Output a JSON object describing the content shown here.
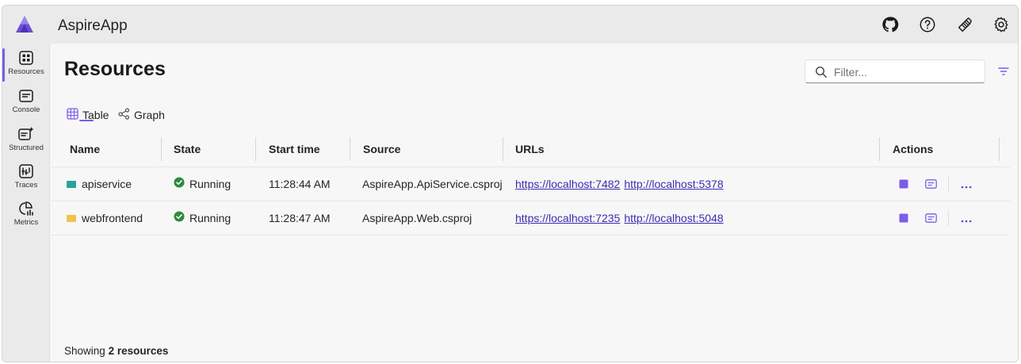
{
  "app": {
    "title": "AspireApp",
    "accent_color": "#7b5de8",
    "logo_icon": "aspire-logo-icon"
  },
  "header_icons": [
    {
      "name": "github-icon"
    },
    {
      "name": "help-icon"
    },
    {
      "name": "learn-icon"
    },
    {
      "name": "settings-icon"
    }
  ],
  "sidebar": {
    "items": [
      {
        "label": "Resources",
        "icon": "resources-icon",
        "active": true
      },
      {
        "label": "Console",
        "icon": "console-icon",
        "active": false
      },
      {
        "label": "Structured",
        "icon": "structured-logs-icon",
        "active": false
      },
      {
        "label": "Traces",
        "icon": "traces-icon",
        "active": false
      },
      {
        "label": "Metrics",
        "icon": "metrics-icon",
        "active": false
      }
    ]
  },
  "main": {
    "title": "Resources",
    "filter": {
      "placeholder": "Filter...",
      "value": ""
    },
    "tabs": [
      {
        "label": "Table",
        "icon": "table-icon",
        "selected": true
      },
      {
        "label": "Graph",
        "icon": "graph-icon",
        "selected": false
      }
    ]
  },
  "table": {
    "columns": [
      "Name",
      "State",
      "Start time",
      "Source",
      "URLs",
      "Actions"
    ],
    "rows": [
      {
        "name": "apiservice",
        "type_color": "#2aa39a",
        "state": "Running",
        "start_time": "11:28:44 AM",
        "source": "AspireApp.ApiService.csproj",
        "urls": [
          "https://localhost:7482",
          "http://localhost:5378"
        ]
      },
      {
        "name": "webfrontend",
        "type_color": "#f2c14e",
        "state": "Running",
        "start_time": "11:28:47 AM",
        "source": "AspireApp.Web.csproj",
        "urls": [
          "https://localhost:7235",
          "http://localhost:5048"
        ]
      }
    ]
  },
  "footer": {
    "prefix": "Showing",
    "count_text": "2 resources"
  },
  "colors": {
    "running": "#2e8b3a",
    "link": "#3a2db0",
    "stop": "#7b5de8"
  }
}
